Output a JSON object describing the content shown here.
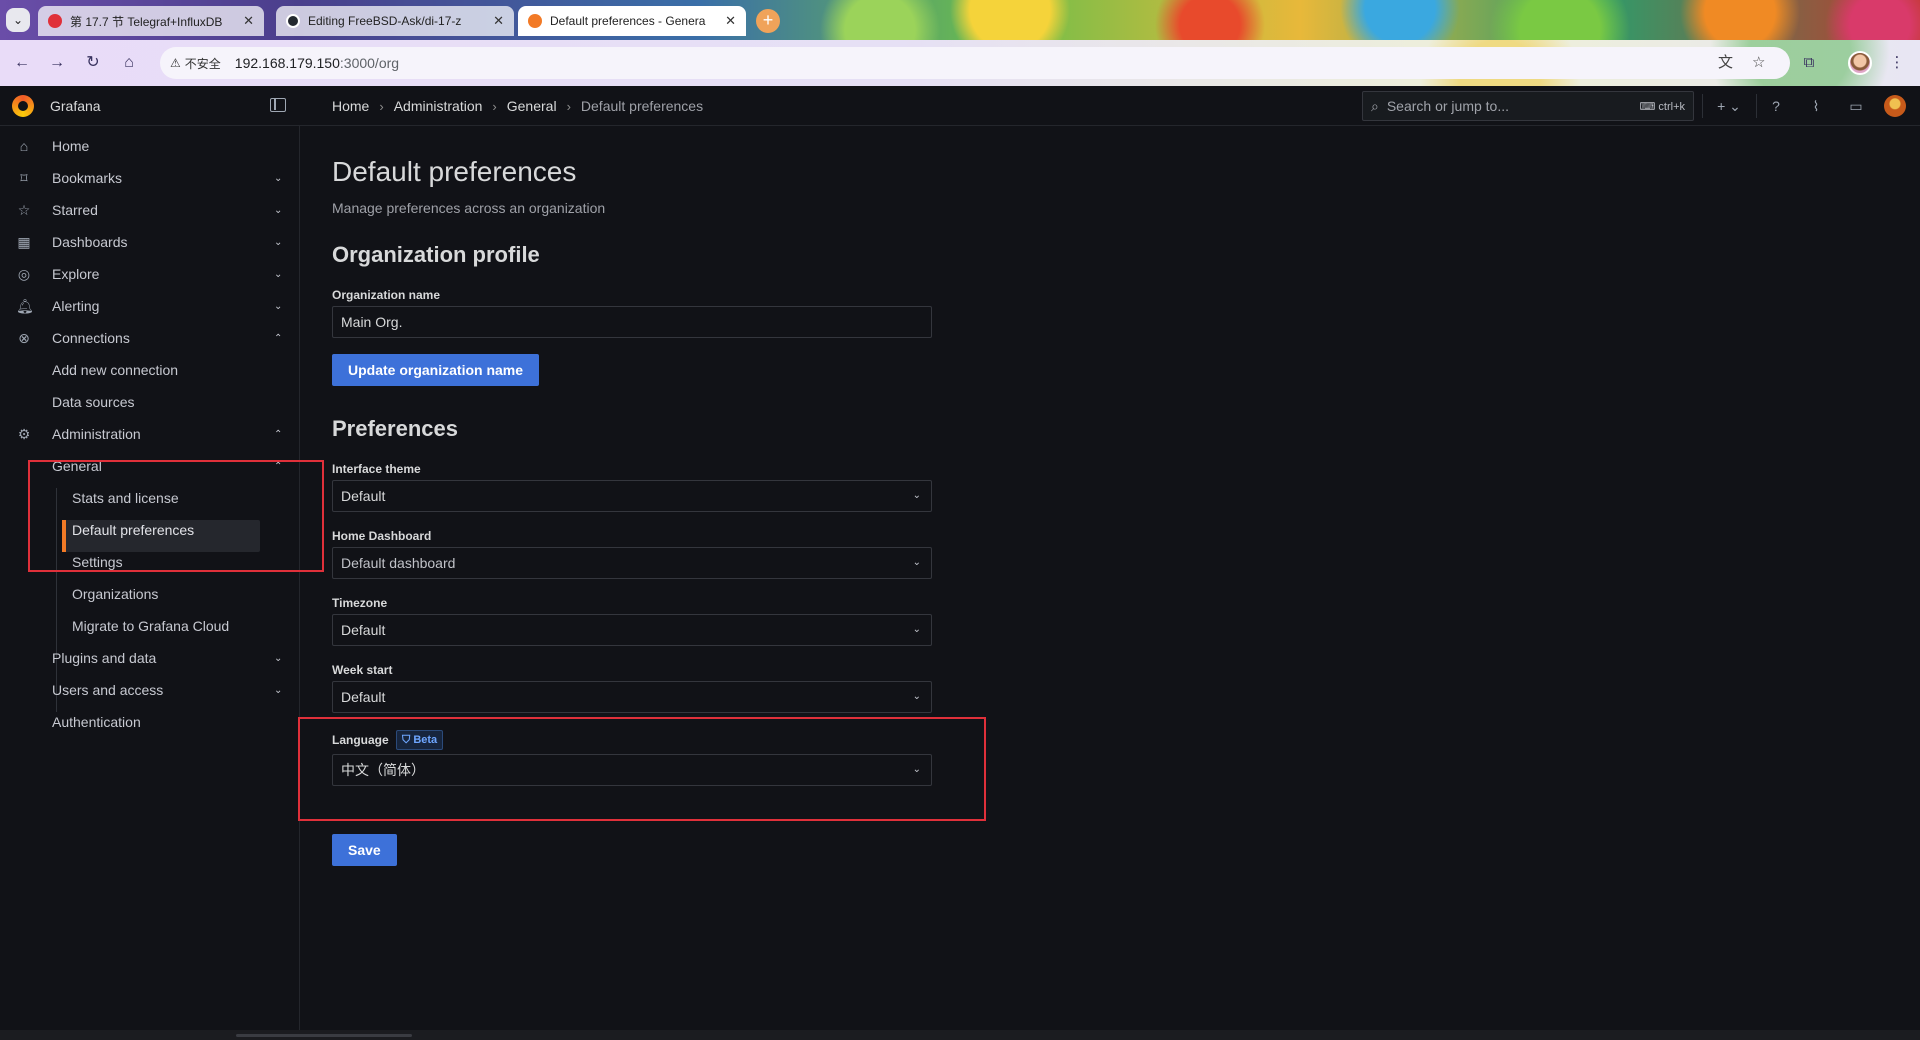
{
  "browser": {
    "tabs": [
      {
        "title": "第 17.7 节 Telegraf+InfluxDB",
        "favicon_color": "#e0303a"
      },
      {
        "title": "Editing FreeBSD-Ask/di-17-z",
        "favicon_color": "#24292f"
      },
      {
        "title": "Default preferences - Genera",
        "favicon_color": "#f27a26"
      }
    ],
    "security_label": "不安全",
    "url_host": "192.168.179.150",
    "url_rest": ":3000/org"
  },
  "topbar": {
    "brand": "Grafana",
    "breadcrumb": [
      "Home",
      "Administration",
      "General",
      "Default preferences"
    ],
    "search_placeholder": "Search or jump to...",
    "search_shortcut": "ctrl+k"
  },
  "sidebar": {
    "items": [
      {
        "label": "Home",
        "icon": "home-icon"
      },
      {
        "label": "Bookmarks",
        "icon": "bookmark-icon"
      },
      {
        "label": "Starred",
        "icon": "star-icon"
      },
      {
        "label": "Dashboards",
        "icon": "grid-icon"
      },
      {
        "label": "Explore",
        "icon": "compass-icon"
      },
      {
        "label": "Alerting",
        "icon": "bell-icon"
      },
      {
        "label": "Connections",
        "icon": "plug-icon"
      },
      {
        "label": "Add new connection"
      },
      {
        "label": "Data sources"
      },
      {
        "label": "Administration",
        "icon": "gear-icon"
      },
      {
        "label": "General"
      },
      {
        "label": "Stats and license"
      },
      {
        "label": "Default preferences"
      },
      {
        "label": "Settings"
      },
      {
        "label": "Organizations"
      },
      {
        "label": "Migrate to Grafana Cloud"
      },
      {
        "label": "Plugins and data"
      },
      {
        "label": "Users and access"
      },
      {
        "label": "Authentication"
      }
    ],
    "accent_color": "#f27a26"
  },
  "main": {
    "title": "Default preferences",
    "subtitle": "Manage preferences across an organization",
    "org_section_title": "Organization profile",
    "org_name_label": "Organization name",
    "org_name_value": "Main Org.",
    "update_button": "Update organization name",
    "prefs_section_title": "Preferences",
    "theme_label": "Interface theme",
    "theme_value": "Default",
    "home_dashboard_label": "Home Dashboard",
    "home_dashboard_value": "Default dashboard",
    "timezone_label": "Timezone",
    "timezone_value": "Default",
    "week_start_label": "Week start",
    "week_start_value": "Default",
    "language_label": "Language",
    "beta_badge": "Beta",
    "language_value": "中文（简体）",
    "save_button": "Save",
    "primary_color": "#3d71d9"
  },
  "annotations": {
    "color": "#e0303a"
  }
}
